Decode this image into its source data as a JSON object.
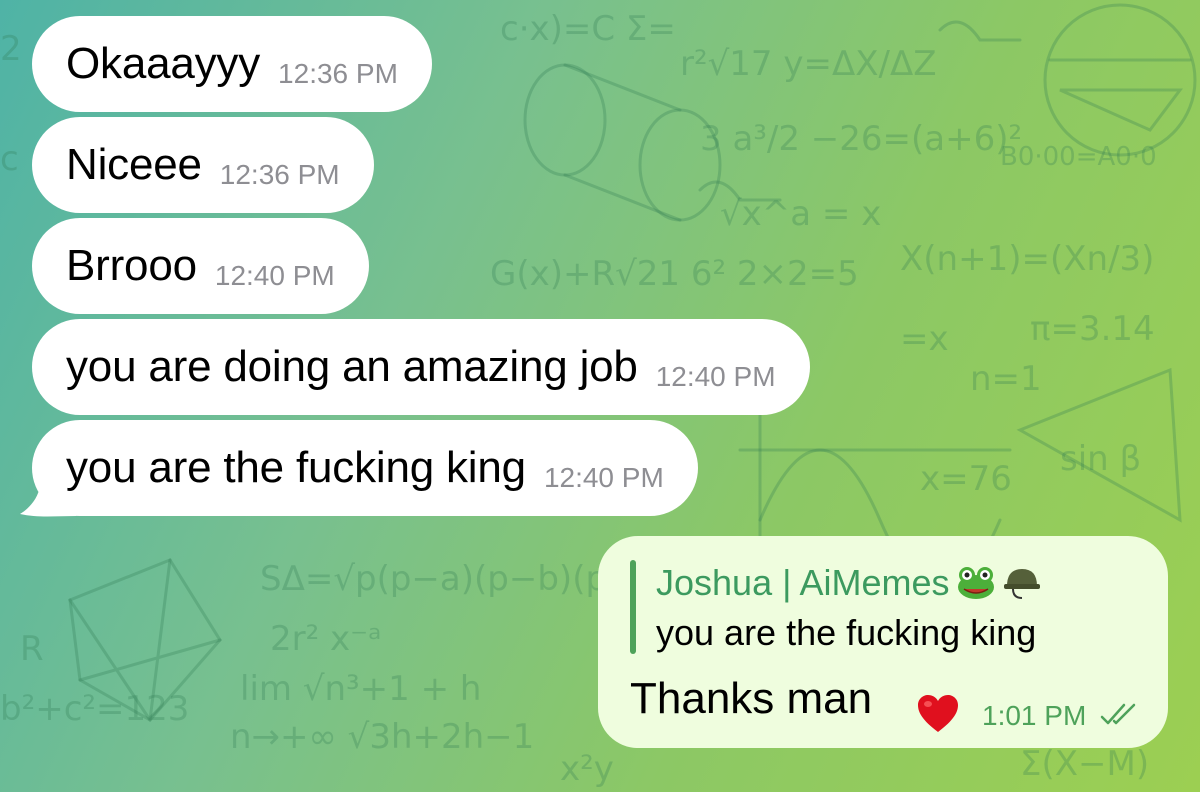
{
  "messages_in": [
    {
      "text": "Okaaayyy",
      "time": "12:36 PM"
    },
    {
      "text": "Niceee",
      "time": "12:36 PM"
    },
    {
      "text": "Brrooo",
      "time": "12:40 PM"
    },
    {
      "text": "you are doing an amazing job",
      "time": "12:40 PM"
    },
    {
      "text": "you are the fucking king",
      "time": "12:40 PM"
    }
  ],
  "message_out": {
    "reply": {
      "author": "Joshua | AiMemes",
      "author_icons": [
        "frog-face-icon",
        "military-helmet-icon"
      ],
      "quote": "you are the fucking king"
    },
    "text": "Thanks man",
    "reaction": "red-heart-icon",
    "time": "1:01 PM",
    "status": "double-check-read-icon"
  },
  "colors": {
    "incoming_bubble": "#ffffff",
    "outgoing_bubble": "#effdde",
    "accent_green": "#4ea25a",
    "timestamp_gray": "#8e8e93",
    "heart_red": "#e0101e"
  }
}
